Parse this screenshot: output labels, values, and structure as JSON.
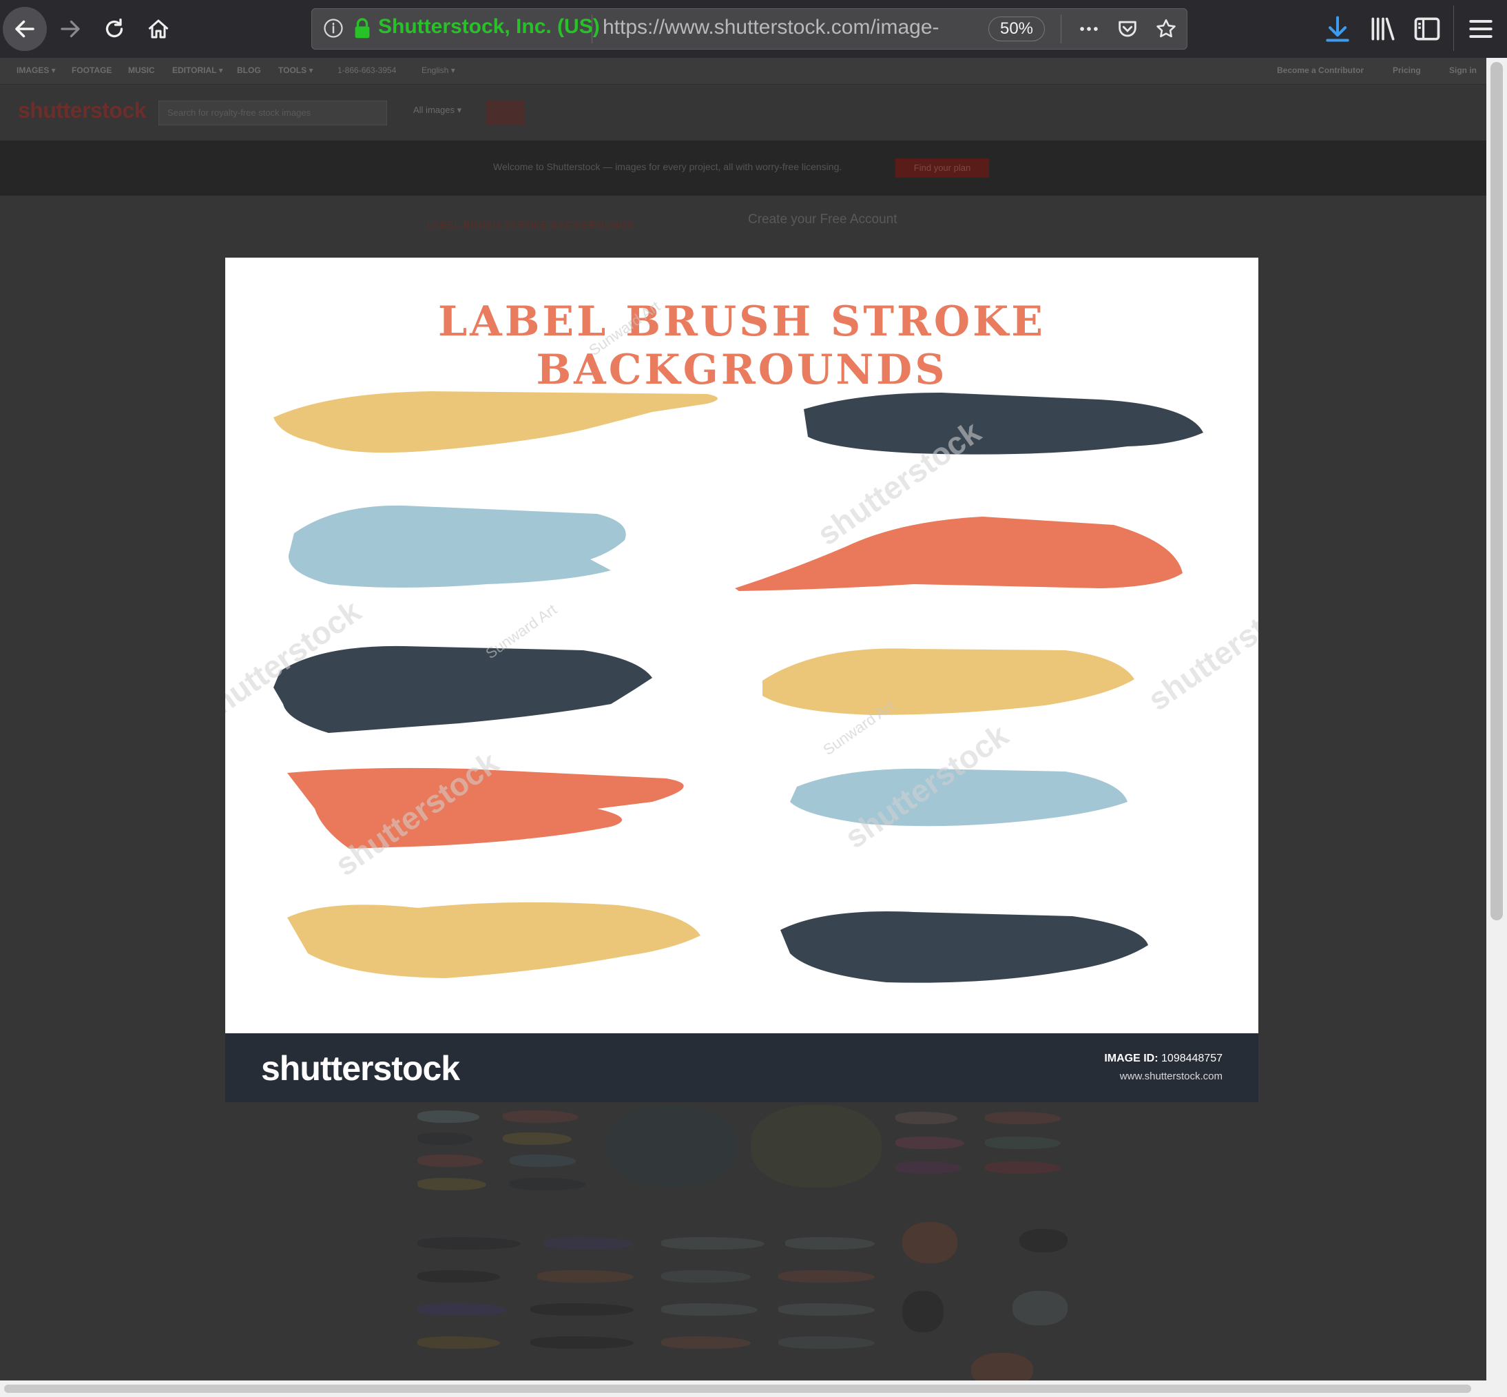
{
  "browser": {
    "org_name": "Shutterstock, Inc. (US)",
    "url": "https://www.shutterstock.com/image-",
    "zoom": "50%",
    "icons": [
      "back-icon",
      "forward-icon",
      "reload-icon",
      "home-icon",
      "info-icon",
      "lock-icon",
      "more-icon",
      "pocket-icon",
      "bookmark-star-icon",
      "download-icon",
      "library-icon",
      "sidebar-icon",
      "menu-icon"
    ]
  },
  "site": {
    "nav": [
      "IMAGES ▾",
      "FOOTAGE",
      "MUSIC",
      "EDITORIAL ▾",
      "BLOG",
      "TOOLS ▾",
      "1-866-663-3954",
      "English ▾"
    ],
    "nav_right": [
      "Become a Contributor",
      "Pricing",
      "Sign in"
    ],
    "logo": "shutterstock",
    "search_placeholder": "Search for royalty-free stock images",
    "search_scope": "All images ▾",
    "banner_text": "Welcome to Shutterstock — images for every project, all with worry-free licensing.",
    "banner_button": "Find your plan",
    "create_account": "Create your Free Account",
    "ghost_title": "LABEL BRUSH STROKE BACKGROUNDS"
  },
  "preview": {
    "title": "LABEL BRUSH STROKE BACKGROUNDS",
    "watermark": "shutterstock",
    "watermark_author": "Sunward Art",
    "footer_logo": "shutterstock",
    "image_id_label": "IMAGE ID:",
    "image_id": "1098448757",
    "footer_url": "www.shutterstock.com",
    "colors": {
      "yellow": "#ecc678",
      "slate": "#384550",
      "blue": "#a2c6d3",
      "coral": "#e9795a"
    }
  }
}
